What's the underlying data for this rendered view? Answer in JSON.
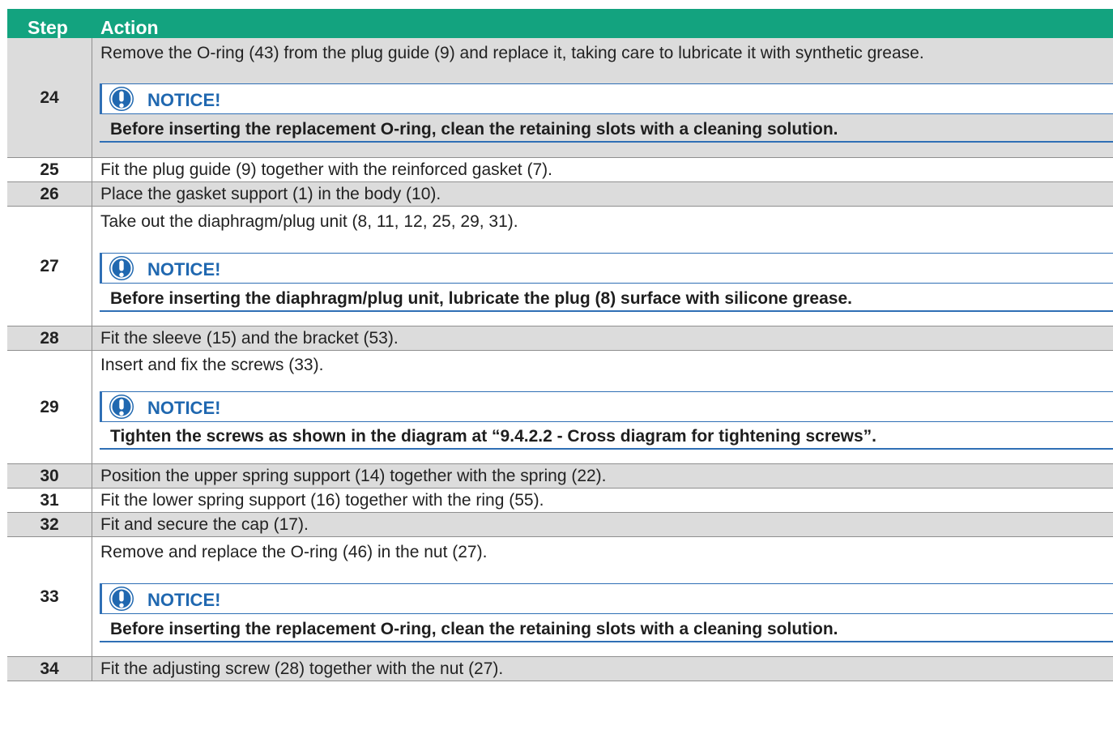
{
  "header": {
    "step": "Step",
    "action": "Action"
  },
  "rows": [
    {
      "step": "24",
      "text": "Remove the O-ring (43) from the plug guide (9) and replace it, taking care to lubricate it with synthetic grease.",
      "notice_title": "NOTICE!",
      "notice_text": "Before inserting the replacement O-ring, clean the retaining slots with a cleaning solution."
    },
    {
      "step": "25",
      "text": "Fit the plug guide (9) together with the reinforced gasket (7)."
    },
    {
      "step": "26",
      "text": "Place the gasket support (1) in the body (10)."
    },
    {
      "step": "27",
      "text": "Take out the diaphragm/plug unit (8, 11, 12, 25, 29, 31).",
      "notice_title": "NOTICE!",
      "notice_text": "Before inserting the diaphragm/plug unit, lubricate the plug (8) surface with silicone grease."
    },
    {
      "step": "28",
      "text": "Fit the sleeve (15) and the bracket (53)."
    },
    {
      "step": "29",
      "text": "Insert and fix the screws (33).",
      "notice_title": "NOTICE!",
      "notice_text": "Tighten the screws as shown in the diagram at “9.4.2.2  - Cross diagram for tightening screws”."
    },
    {
      "step": "30",
      "text": "Position the upper spring support (14) together with the spring (22)."
    },
    {
      "step": "31",
      "text": "Fit the lower spring support (16) together with the ring (55)."
    },
    {
      "step": "32",
      "text": "Fit and secure the cap (17)."
    },
    {
      "step": "33",
      "text": "Remove and replace the O-ring (46) in the nut (27).",
      "notice_title": "NOTICE!",
      "notice_text": "Before inserting the replacement O-ring, clean the retaining slots with a cleaning solution."
    },
    {
      "step": "34",
      "text": "Fit the adjusting screw (28) together with the nut (27)."
    }
  ],
  "colors": {
    "header": "#13a37f",
    "notice": "#2068b0",
    "shaded": "#dcdcdc"
  },
  "icons": {
    "notice": "exclamation-circle-icon"
  }
}
